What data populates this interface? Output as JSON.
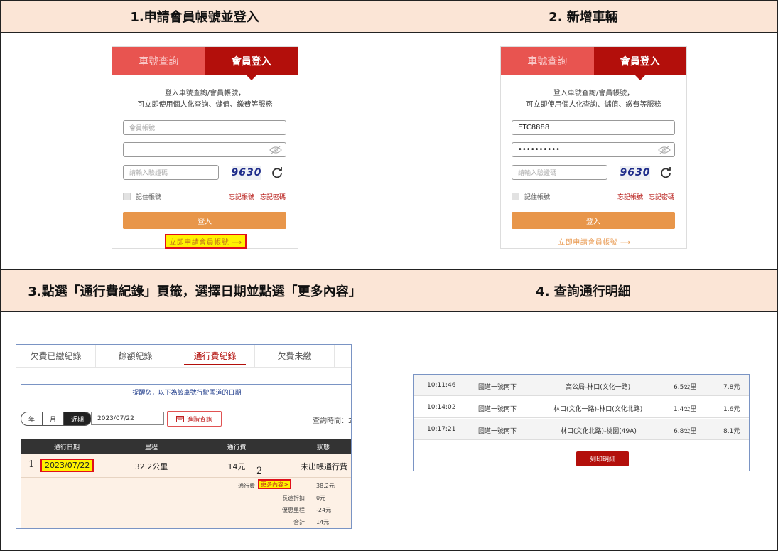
{
  "steps": [
    {
      "title": "1.申請會員帳號並登入"
    },
    {
      "title": "2. 新增車輛"
    },
    {
      "title": "3.點選「通行費紀錄」頁籤，選擇日期並點選「更多內容」"
    },
    {
      "title": "4. 查詢通行明細"
    }
  ],
  "login1": {
    "tab_plate": "車號查詢",
    "tab_member": "會員登入",
    "intro_line1": "登入車號查詢/會員帳號，",
    "intro_line2": "可立即使用個人化查詢、儲值、繳費等服務",
    "account_placeholder": "會員帳號",
    "password_value": "",
    "captcha_placeholder": "請輸入驗證碼",
    "captcha_code": "9630",
    "remember_label": "記住帳號",
    "forgot_account": "忘記帳號",
    "forgot_password": "忘記密碼",
    "login_button": "登入",
    "apply_link": "立即申請會員帳號 ⟶"
  },
  "login2": {
    "tab_plate": "車號查詢",
    "tab_member": "會員登入",
    "intro_line1": "登入車號查詢/會員帳號，",
    "intro_line2": "可立即使用個人化查詢、儲值、繳費等服務",
    "account_value": "ETC8888",
    "password_value": "••••••••••",
    "captcha_placeholder": "請輸入驗證碼",
    "captcha_code": "9630",
    "remember_label": "記住帳號",
    "forgot_account": "忘記帳號",
    "forgot_password": "忘記密碼",
    "login_button": "登入",
    "apply_link": "立即申請會員帳號 ⟶"
  },
  "records": {
    "tabs": [
      "欠費已繳紀錄",
      "餘額紀錄",
      "通行費紀錄",
      "欠費未繳"
    ],
    "active_tab": 2,
    "notice": "提醒您，以下為該車號行駛國道的日期",
    "segments": [
      "年",
      "月",
      "近期"
    ],
    "date_value": "2023/07/22",
    "advanced_button": "進階查詢",
    "query_time_label": "查詢時間：2",
    "columns": [
      "通行日期",
      "里程",
      "通行費",
      "狀態"
    ],
    "row": {
      "date": "2023/07/22",
      "mileage": "32.2公里",
      "fee": "14元",
      "status": "未出帳通行費"
    },
    "marker1": "1",
    "marker2": "2",
    "detail": {
      "fee_label": "通行費",
      "more_link": "更多內容>",
      "fee_value": "38.2元",
      "discount_label": "長途折扣",
      "discount_value": "0元",
      "preferential_label": "優惠里程",
      "preferential_value": "-24元",
      "total_label": "合計",
      "total_value": "14元"
    }
  },
  "details": {
    "rows": [
      {
        "time": "10:11:46",
        "road": "國道一號南下",
        "section": "高公局-林口(文化一路)",
        "distance": "6.5公里",
        "fee": "7.8元"
      },
      {
        "time": "10:14:02",
        "road": "國道一號南下",
        "section": "林口(文化一路)-林口(文化北路)",
        "distance": "1.4公里",
        "fee": "1.6元"
      },
      {
        "time": "10:17:21",
        "road": "國道一號南下",
        "section": "林口(文化北路)-桃園(49A)",
        "distance": "6.8公里",
        "fee": "8.1元"
      }
    ],
    "print_button": "列印明細"
  },
  "colors": {
    "header_bg": "#fbe5d6",
    "brand_red": "#b30f0b",
    "tab_red": "#e85450",
    "orange": "#e8964a",
    "highlight": "#fff200"
  }
}
